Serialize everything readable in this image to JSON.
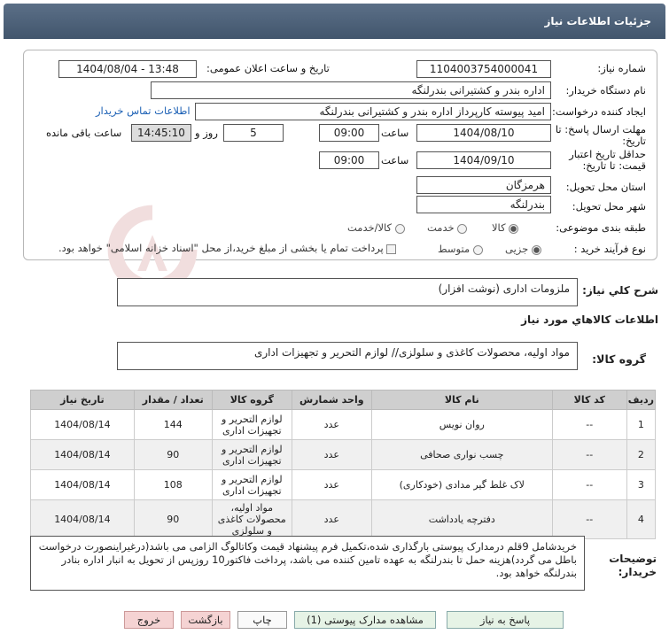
{
  "header": {
    "title": "جزئیات اطلاعات نیاز"
  },
  "form": {
    "need_number_label": "شماره نیاز:",
    "need_number": "1104003754000041",
    "announce_label": "تاریخ و ساعت اعلان عمومی:",
    "announce_value": "1404/08/04 - 13:48",
    "buyer_org_label": "نام دستگاه خریدار:",
    "buyer_org": "اداره بندر و کشتیرانی بندرلنگه",
    "creator_label": "ایجاد کننده درخواست:",
    "creator": "امید پیوسته کارپرداز اداره بندر و کشتیرانی بندرلنگه",
    "contact_link": "اطلاعات تماس خریدار",
    "deadline_label_1": "مهلت ارسال پاسخ: تا",
    "deadline_label_2": "تاریخ:",
    "deadline_date": "1404/08/10",
    "time_label": "ساعت",
    "deadline_time": "09:00",
    "days_value": "5",
    "days_label": "روز و",
    "remaining_time": "14:45:10",
    "remaining_label": "ساعت باقی مانده",
    "validity_label_1": "حداقل تاریخ اعتبار",
    "validity_label_2": "قیمت: تا تاریخ:",
    "validity_date": "1404/09/10",
    "validity_time": "09:00",
    "province_label": "استان محل تحویل:",
    "province": "هرمزگان",
    "city_label": "شهر محل تحویل:",
    "city": "بندرلنگه",
    "category_label": "طبقه بندی موضوعی:",
    "category_options": [
      "کالا",
      "خدمت",
      "کالا/خدمت"
    ],
    "category_selected": "کالا",
    "process_label": "نوع فرآیند خرید :",
    "process_options": [
      "جزیی",
      "متوسط"
    ],
    "process_selected": "جزیی",
    "payment_note": "پرداخت تمام یا بخشی از مبلغ خرید،از محل \"اسناد خزانه اسلامی\" خواهد بود."
  },
  "summary": {
    "label": "شرح كلي نياز:",
    "value": "ملزومات اداری (نوشت افزار)"
  },
  "goods_info_title": "اطلاعات كالاهاي مورد نياز",
  "goods_group": {
    "label": "گروه کالا:",
    "value": "مواد اولیه، محصولات کاغذی و سلولزی// لوازم التحریر و تجهیزات اداری"
  },
  "table": {
    "headers": [
      "ردیف",
      "کد کالا",
      "نام کالا",
      "واحد شمارش",
      "گروه کالا",
      "تعداد / مقدار",
      "تاریخ نیاز"
    ],
    "rows": [
      {
        "row": "1",
        "code": "--",
        "name": "روان نویس",
        "unit": "عدد",
        "group": "لوازم التحریر و تجهیزات اداری",
        "qty": "144",
        "date": "1404/08/14"
      },
      {
        "row": "2",
        "code": "--",
        "name": "چسب نواری صحافی",
        "unit": "عدد",
        "group": "لوازم التحریر و تجهیزات اداری",
        "qty": "90",
        "date": "1404/08/14"
      },
      {
        "row": "3",
        "code": "--",
        "name": "لاک غلط گیر مدادی (خودکاری)",
        "unit": "عدد",
        "group": "لوازم التحریر و تجهیزات اداری",
        "qty": "108",
        "date": "1404/08/14"
      },
      {
        "row": "4",
        "code": "--",
        "name": "دفترچه یادداشت",
        "unit": "عدد",
        "group": "مواد اولیه، محصولات کاغذی و سلولزی",
        "qty": "90",
        "date": "1404/08/14"
      }
    ]
  },
  "buyer_notes": {
    "label_1": "توضیحات",
    "label_2": "خریدار:",
    "text": "خریدشامل 9قلم درمدارک پیوستی بارگذاری شده،تکمیل فرم پیشنهاد قیمت وکاتالوگ الزامی می باشد(درغیراینصورت درخواست باطل می گردد)هزینه حمل تا بندرلنگه به عهده تامین کننده می باشد، پرداخت فاکتور10 روزپس از تحویل به انبار اداره بنادر بندرلنگه خواهد بود."
  },
  "buttons": {
    "reply": "پاسخ به نیاز",
    "attachments": "مشاهده مدارک پیوستی (1)",
    "print": "چاپ",
    "back": "بازگشت",
    "exit": "خروج"
  },
  "colors": {
    "header_bg": "#4a5e76",
    "link": "#1a5fb4",
    "table_header": "#cfcfcf"
  }
}
